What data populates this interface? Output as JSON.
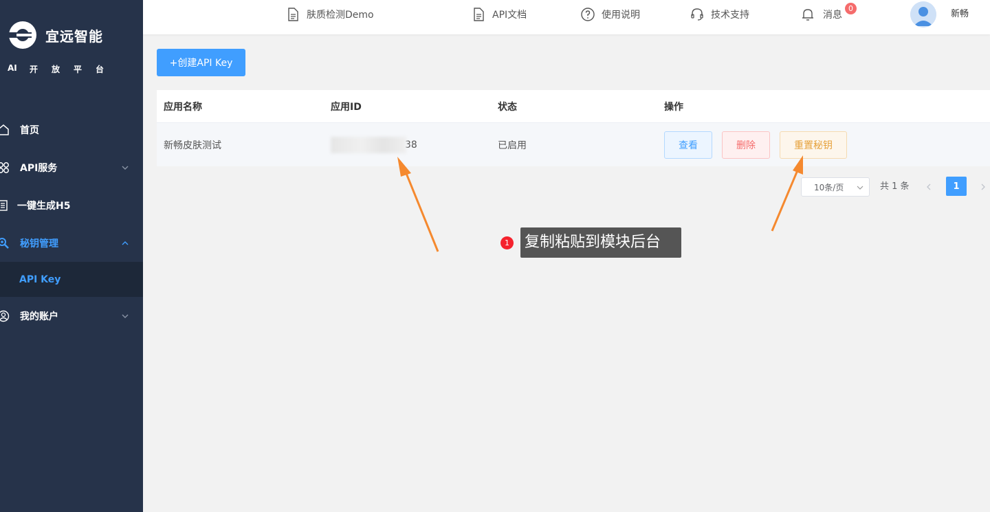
{
  "sidebar": {
    "brand": "宜远智能",
    "tagline": [
      "AI",
      "开",
      "放",
      "平",
      "台"
    ],
    "items": [
      {
        "label": "首页"
      },
      {
        "label": "API服务"
      },
      {
        "label": "一键生成H5"
      },
      {
        "label": "秘钥管理"
      },
      {
        "label": "API Key"
      },
      {
        "label": "我的账户"
      }
    ]
  },
  "header": {
    "demo": "肤质检测Demo",
    "api_docs": "API文档",
    "usage": "使用说明",
    "support": "技术支持",
    "messages": "消息",
    "message_count": "0",
    "username": "新畅"
  },
  "toolbar": {
    "create_label": "+创建API Key"
  },
  "table": {
    "columns": [
      "应用名称",
      "应用ID",
      "状态",
      "操作"
    ],
    "rows": [
      {
        "name": "新畅皮肤测试",
        "id_suffix": "38",
        "status": "已启用"
      }
    ],
    "actions": {
      "view": "查看",
      "delete": "删除",
      "reset": "重置秘钥"
    }
  },
  "pagination": {
    "page_size": "10条/页",
    "total": "共 1 条",
    "current_page": "1"
  },
  "annotation": {
    "number": "1",
    "text": "复制粘贴到模块后台",
    "color": "#f5892f"
  },
  "colors": {
    "sidebar_bg": "#26334a",
    "accent": "#409eff"
  }
}
